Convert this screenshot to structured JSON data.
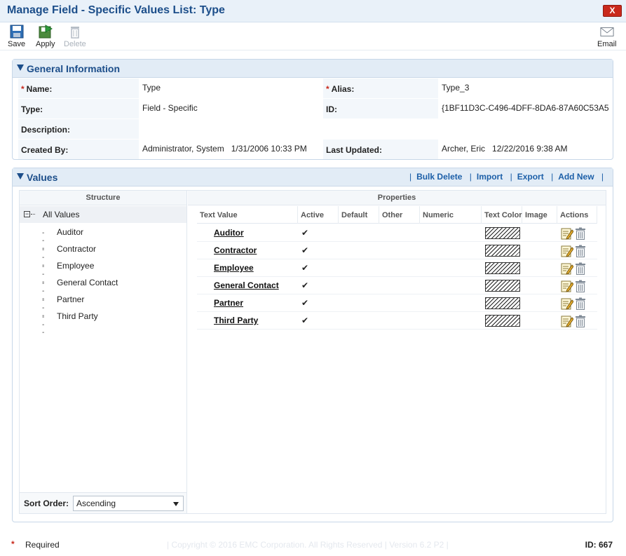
{
  "window": {
    "title": "Manage Field - Specific Values List: Type",
    "close_label": "X"
  },
  "toolbar": {
    "save_label": "Save",
    "apply_label": "Apply",
    "delete_label": "Delete",
    "email_label": "Email"
  },
  "general": {
    "section_title": "General Information",
    "name_label": "Name:",
    "name_value": "Type",
    "alias_label": "Alias:",
    "alias_value": "Type_3",
    "type_label": "Type:",
    "type_value": "Field - Specific",
    "id_label": "ID:",
    "id_value": "{1BF11D3C-C496-4DFF-8DA6-87A60C53A5",
    "description_label": "Description:",
    "description_value": "",
    "created_by_label": "Created By:",
    "created_by_value": "Administrator, System   1/31/2006 10:33 PM",
    "last_updated_label": "Last Updated:",
    "last_updated_value": "Archer, Eric   12/22/2016 9:38 AM"
  },
  "values": {
    "section_title": "Values",
    "links": [
      "Bulk Delete",
      "Import",
      "Export",
      "Add New"
    ],
    "structure_header": "Structure",
    "properties_header": "Properties",
    "tree_root": "All Values",
    "tree_items": [
      "Auditor",
      "Contractor",
      "Employee",
      "General Contact",
      "Partner",
      "Third Party"
    ],
    "columns": [
      "Text Value",
      "Active",
      "Default",
      "Other",
      "Numeric",
      "Text Color",
      "Image",
      "Actions"
    ],
    "rows": [
      {
        "text": "Auditor",
        "active": "✔"
      },
      {
        "text": "Contractor",
        "active": "✔"
      },
      {
        "text": "Employee",
        "active": "✔"
      },
      {
        "text": "General Contact",
        "active": "✔"
      },
      {
        "text": "Partner",
        "active": "✔"
      },
      {
        "text": "Third Party",
        "active": "✔"
      }
    ],
    "sort_label": "Sort Order:",
    "sort_value": "Ascending"
  },
  "footer": {
    "required_label": "Required",
    "copyright": "|  Copyright © 2016 EMC Corporation.  All Rights Reserved  |  Version 6.2 P2  |",
    "id_text": "ID: 667"
  },
  "colors": {
    "title": "#1c4e8a",
    "link": "#1c5fa8",
    "required": "#c8281b",
    "header_bg": "#e2ecf6"
  }
}
